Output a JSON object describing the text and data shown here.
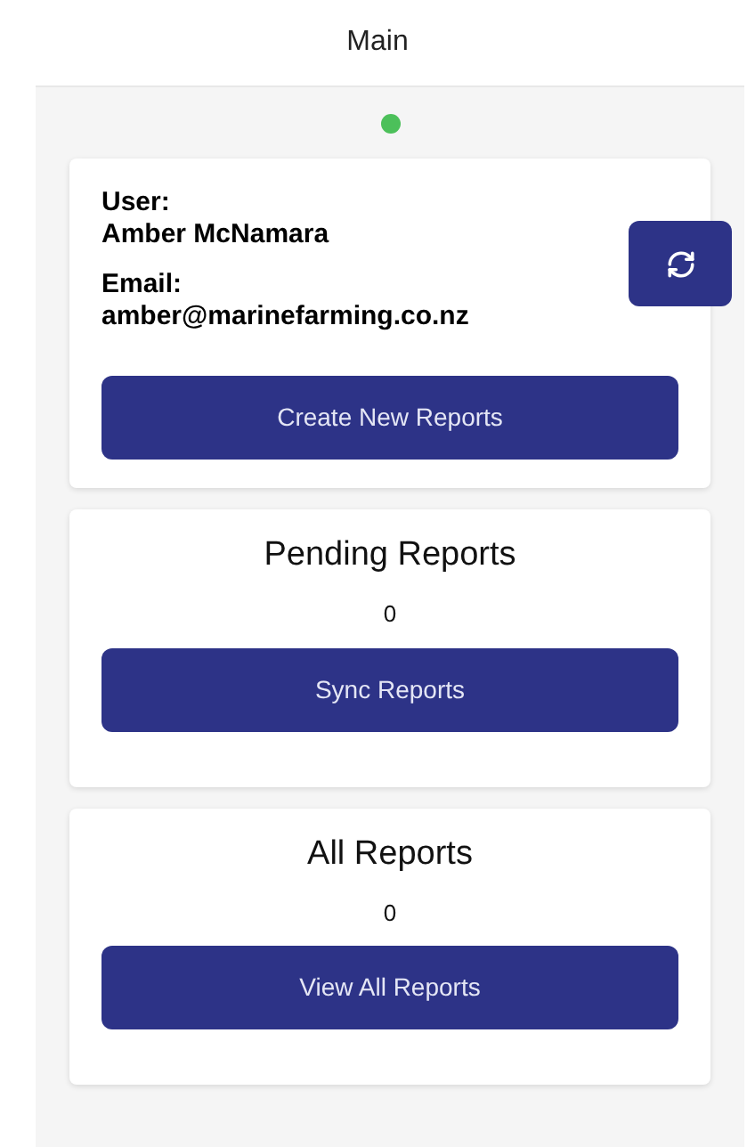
{
  "header": {
    "title": "Main"
  },
  "connection": {
    "online": true
  },
  "user_card": {
    "user_label": "User:",
    "user_name": "Amber McNamara",
    "email_label": "Email:",
    "email": "amber@marinefarming.co.nz",
    "button": "Create New Reports"
  },
  "report_cards": [
    {
      "title": "Pending Reports",
      "count": "0",
      "button": "Sync Reports"
    },
    {
      "title": "All Reports",
      "count": "0",
      "button": "View All Reports"
    }
  ]
}
